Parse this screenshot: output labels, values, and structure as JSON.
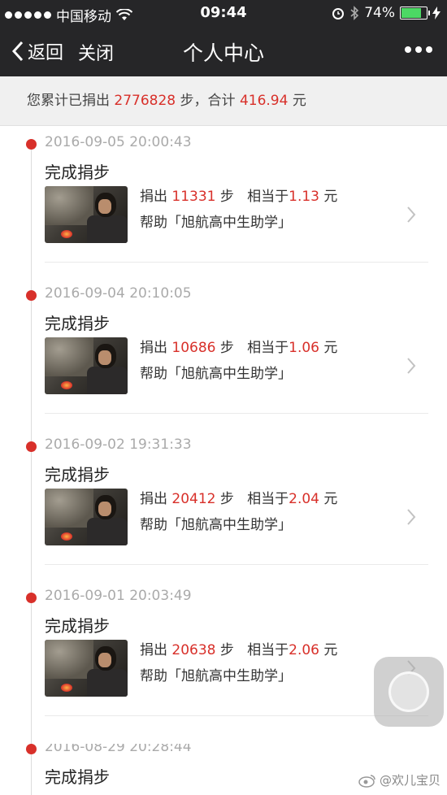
{
  "status_bar": {
    "carrier": "中国移动",
    "time": "09:44",
    "battery_percent": "74%",
    "battery_color": "#4cd964",
    "icons": [
      "signal-dots-icon",
      "wifi-icon",
      "alarm-icon",
      "bluetooth-icon",
      "battery-icon",
      "charging-icon"
    ]
  },
  "nav": {
    "back_label": "返回",
    "close_label": "关闭",
    "title": "个人中心",
    "more_icon": "more-dots-icon"
  },
  "summary": {
    "prefix": "您累计已捐出",
    "steps": "2776828",
    "steps_unit": "步，合计",
    "amount": "416.94",
    "amount_unit": "元"
  },
  "entries": [
    {
      "date": "2016-09-05 20:00:43",
      "status": "完成捐步",
      "donate_label": "捐出",
      "steps": "11331",
      "steps_unit": "步",
      "equiv_label": "相当于",
      "amount": "1.13",
      "amount_unit": "元",
      "help_text": "帮助「旭航高中生助学」"
    },
    {
      "date": "2016-09-04 20:10:05",
      "status": "完成捐步",
      "donate_label": "捐出",
      "steps": "10686",
      "steps_unit": "步",
      "equiv_label": "相当于",
      "amount": "1.06",
      "amount_unit": "元",
      "help_text": "帮助「旭航高中生助学」"
    },
    {
      "date": "2016-09-02 19:31:33",
      "status": "完成捐步",
      "donate_label": "捐出",
      "steps": "20412",
      "steps_unit": "步",
      "equiv_label": "相当于",
      "amount": "2.04",
      "amount_unit": "元",
      "help_text": "帮助「旭航高中生助学」"
    },
    {
      "date": "2016-09-01 20:03:49",
      "status": "完成捐步",
      "donate_label": "捐出",
      "steps": "20638",
      "steps_unit": "步",
      "equiv_label": "相当于",
      "amount": "2.06",
      "amount_unit": "元",
      "help_text": "帮助「旭航高中生助学」"
    },
    {
      "date": "2016-08-29 20:28:44",
      "status": "完成捐步"
    }
  ],
  "watermark": "@欢儿宝贝",
  "colors": {
    "accent_red": "#d8302a",
    "nav_bg": "#262628",
    "summary_bg": "#f0f0f0"
  }
}
